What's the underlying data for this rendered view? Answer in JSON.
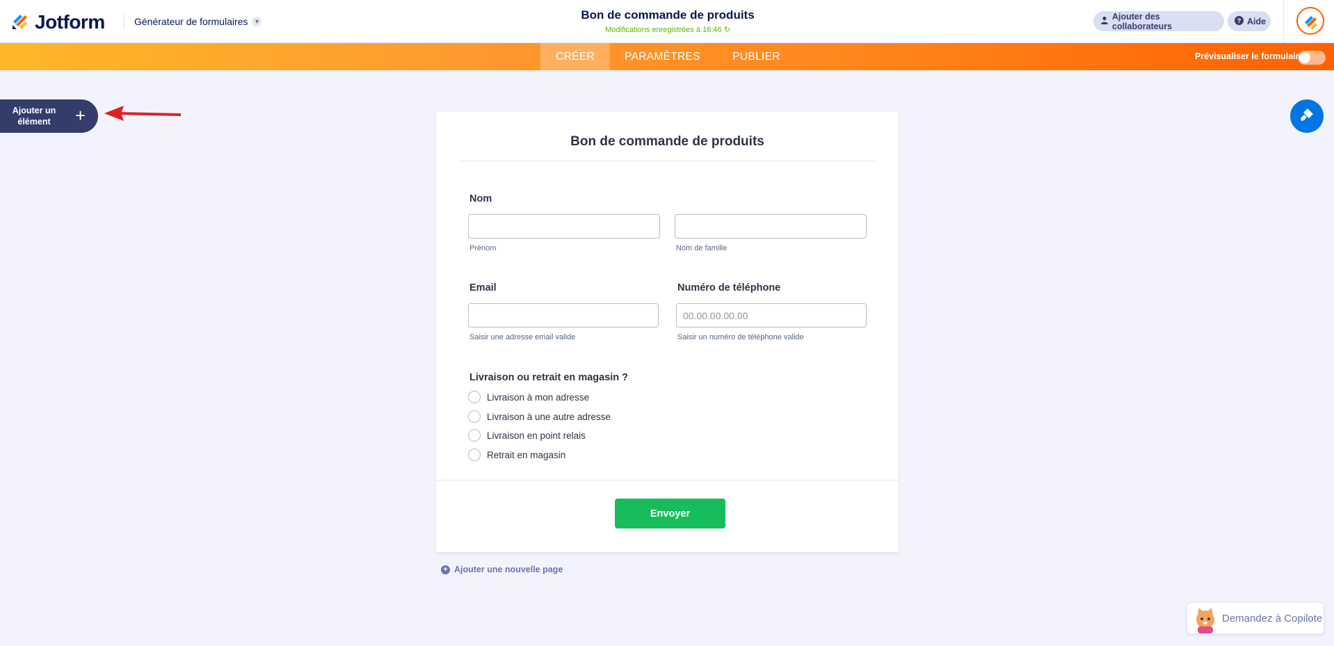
{
  "header": {
    "logo_text": "Jotform",
    "builder_label": "Générateur de formulaires",
    "form_title": "Bon de commande de produits",
    "save_status": "Modifications enregistrées à 16:46",
    "collab_label": "Ajouter des collaborateurs",
    "help_label": "Aide"
  },
  "nav": {
    "tabs": [
      {
        "label": "CRÉER",
        "active": true
      },
      {
        "label": "PARAMÈTRES",
        "active": false
      },
      {
        "label": "PUBLIER",
        "active": false
      }
    ],
    "preview_label": "Prévisualiser le formulaire"
  },
  "sidebar": {
    "add_element_label": "Ajouter un élément",
    "add_element_icon": "+"
  },
  "form": {
    "title": "Bon de commande de produits",
    "name": {
      "label": "Nom",
      "first_sublabel": "Prénom",
      "last_sublabel": "Nom de famille",
      "first_value": "",
      "last_value": ""
    },
    "email": {
      "label": "Email",
      "value": "",
      "sublabel": "Saisir une adresse email valide"
    },
    "phone": {
      "label": "Numéro de téléphone",
      "placeholder": "00.00.00.00.00",
      "sublabel": "Saisir un numéro de téléphone valide"
    },
    "delivery": {
      "label": "Livraison ou retrait en magasin ?",
      "options": [
        "Livraison à mon adresse",
        "Livraison à une autre adresse",
        "Livraison en point relais",
        "Retrait en magasin"
      ]
    },
    "submit_label": "Envoyer"
  },
  "add_page_label": "Ajouter une nouvelle page",
  "copilot_label": "Demandez à Copilote",
  "colors": {
    "nav_gradient_start": "#ffb629",
    "nav_gradient_end": "#ff6100",
    "submit": "#18bd5b",
    "paint_button": "#0075e3",
    "add_element_bg": "#343c6a",
    "saved_text": "#64b200",
    "annotation_arrow": "#e02020"
  },
  "icons": [
    "jotform-logo-icon",
    "chevron-down-icon",
    "user-icon",
    "help-icon",
    "paint-roller-icon",
    "plus-icon",
    "refresh-icon",
    "copilot-avatar-icon"
  ]
}
